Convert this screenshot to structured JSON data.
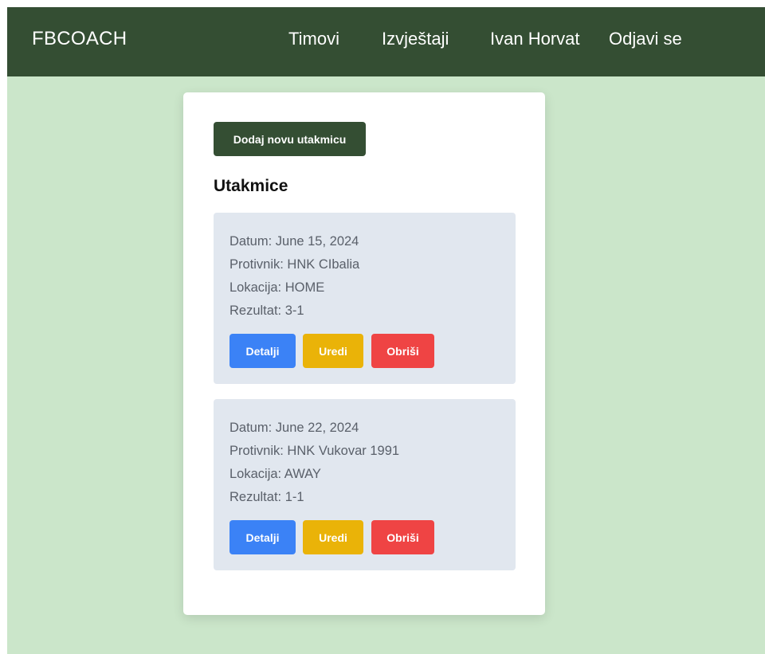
{
  "navbar": {
    "brand": "FBCOACH",
    "links": [
      "Timovi",
      "Izvještaji",
      "Ivan Horvat",
      "Odjavi se"
    ]
  },
  "main": {
    "add_button_label": "Dodaj novu utakmicu",
    "section_title": "Utakmice",
    "matches": [
      {
        "date": "Datum: June 15, 2024",
        "opponent": "Protivnik: HNK CIbalia",
        "location": "Lokacija: HOME",
        "result": "Rezultat: 3-1"
      },
      {
        "date": "Datum: June 22, 2024",
        "opponent": "Protivnik: HNK Vukovar 1991",
        "location": "Lokacija: AWAY",
        "result": "Rezultat: 1-1"
      }
    ],
    "actions": {
      "details": "Detalji",
      "edit": "Uredi",
      "delete": "Obriši"
    }
  },
  "colors": {
    "navbar": "#344e33",
    "background": "#cbe6ca",
    "match_card": "#e1e7ef",
    "details": "#3b82f6",
    "edit": "#eab308",
    "delete": "#ef4444"
  }
}
